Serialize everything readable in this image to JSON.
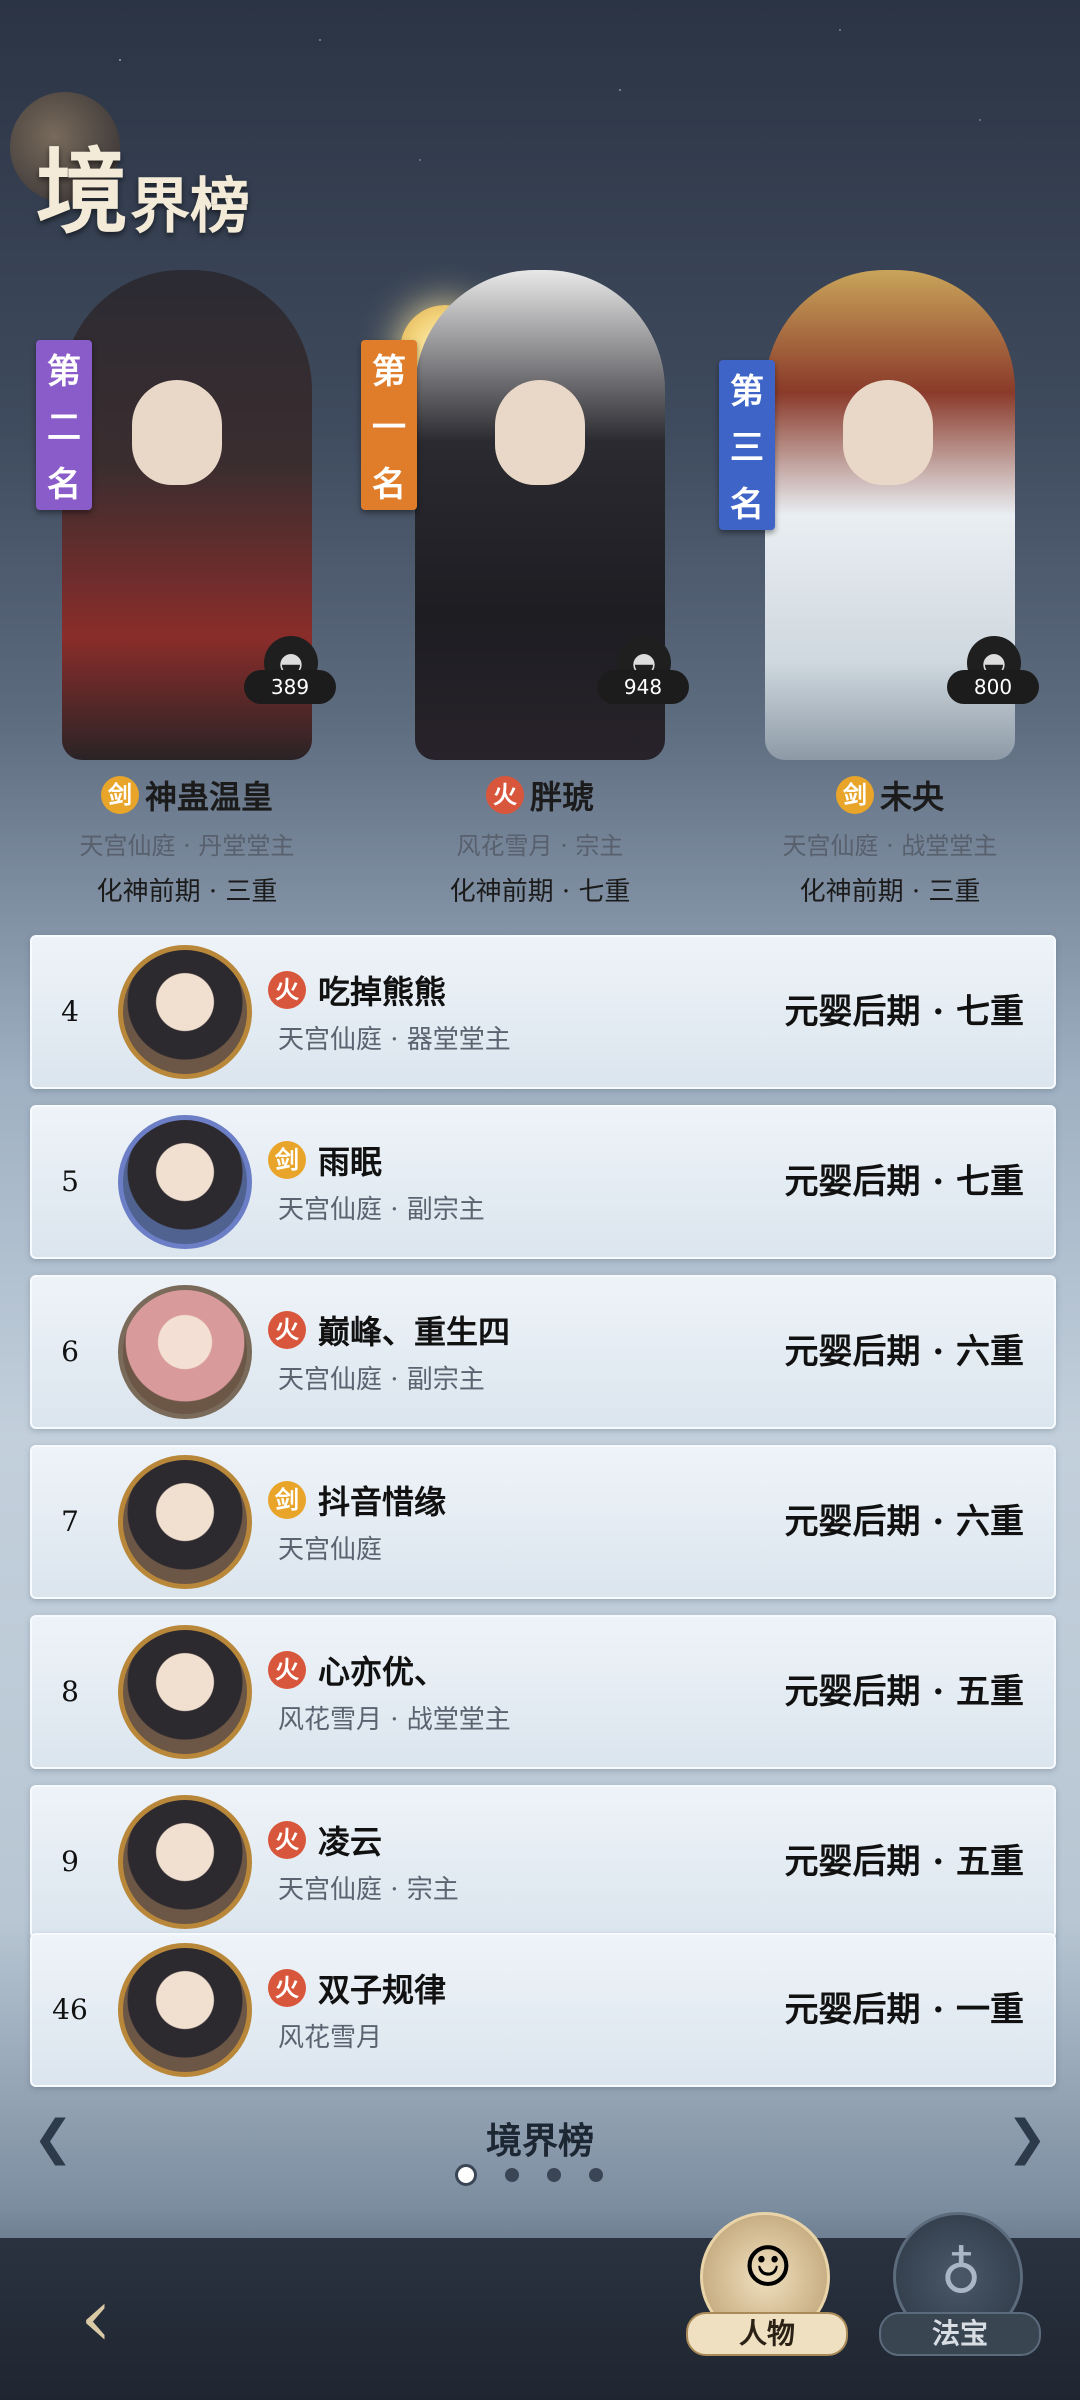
{
  "header": {
    "title_main": "境",
    "title_sub": "界榜"
  },
  "top3": [
    {
      "rank_chars": [
        "第",
        "二",
        "名"
      ],
      "name": "神蛊温皇",
      "element": "剑",
      "element_type": "sword",
      "sect": "天宫仙庭 · 丹堂堂主",
      "realm": "化神前期 · 三重",
      "likes": "389",
      "banner_color": "#8a5cc9"
    },
    {
      "rank_chars": [
        "第",
        "一",
        "名"
      ],
      "name": "胖琥",
      "element": "火",
      "element_type": "fire",
      "sect": "风花雪月 · 宗主",
      "realm": "化神前期 · 七重",
      "likes": "948",
      "banner_color": "#e07d2a"
    },
    {
      "rank_chars": [
        "第",
        "三",
        "名"
      ],
      "name": "未央",
      "element": "剑",
      "element_type": "sword",
      "sect": "天宫仙庭 · 战堂堂主",
      "realm": "化神前期 · 三重",
      "likes": "800",
      "banner_color": "#3f64c8"
    }
  ],
  "ranking": [
    {
      "rank": "4",
      "element": "火",
      "name": "吃掉熊熊",
      "sect": "天宫仙庭 · 器堂堂主",
      "realm": "元婴后期 · 七重"
    },
    {
      "rank": "5",
      "element": "剑",
      "name": "雨眠",
      "sect": "天宫仙庭 · 副宗主",
      "realm": "元婴后期 · 七重"
    },
    {
      "rank": "6",
      "element": "火",
      "name": "巅峰、重生四",
      "sect": "天宫仙庭 · 副宗主",
      "realm": "元婴后期 · 六重"
    },
    {
      "rank": "7",
      "element": "剑",
      "name": "抖音惜缘",
      "sect": "天宫仙庭",
      "realm": "元婴后期 · 六重"
    },
    {
      "rank": "8",
      "element": "火",
      "name": "心亦优、",
      "sect": "风花雪月 · 战堂堂主",
      "realm": "元婴后期 · 五重"
    },
    {
      "rank": "9",
      "element": "火",
      "name": "凌云",
      "sect": "天宫仙庭 · 宗主",
      "realm": "元婴后期 · 五重"
    },
    {
      "rank": "46",
      "element": "火",
      "name": "双子规律",
      "sect": "风花雪月",
      "realm": "元婴后期 · 一重"
    }
  ],
  "footer": {
    "title": "境界榜",
    "pages": 4,
    "current_page": 1
  },
  "nav": {
    "people_label": "人物",
    "treasure_label": "法宝"
  },
  "icons": {
    "prev": "chevron-left-icon",
    "next": "chevron-right-icon",
    "back": "back-arrow-icon",
    "likes": "ink-portrait-icon"
  }
}
